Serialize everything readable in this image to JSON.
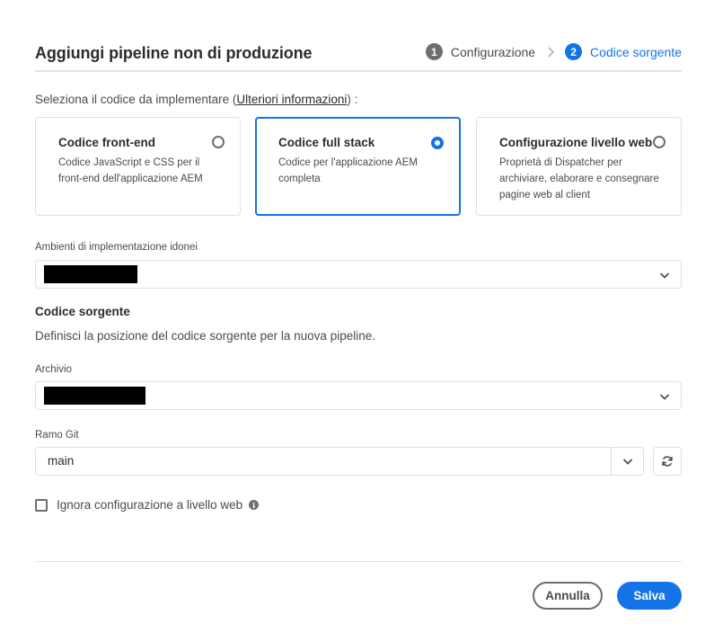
{
  "dialog": {
    "title": "Aggiungi pipeline non di produzione"
  },
  "stepper": {
    "steps": [
      {
        "number": "1",
        "label": "Configurazione",
        "state": "done"
      },
      {
        "number": "2",
        "label": "Codice sorgente",
        "state": "active"
      }
    ]
  },
  "code_selection": {
    "prompt_before": "Seleziona il codice da implementare (",
    "link_label": "Ulteriori informazioni",
    "prompt_after": ") :",
    "options": [
      {
        "title": "Codice front-end",
        "description": "Codice JavaScript e CSS per il front-end dell'applicazione AEM",
        "selected": false
      },
      {
        "title": "Codice full stack",
        "description": "Codice per l'applicazione AEM completa",
        "selected": true
      },
      {
        "title": "Configurazione livello web",
        "description": "Proprietà di Dispatcher per archiviare, elaborare e consegnare pagine web al client",
        "selected": false
      }
    ]
  },
  "environments": {
    "label": "Ambienti di implementazione idonei",
    "value_redacted": true
  },
  "source": {
    "title": "Codice sorgente",
    "description": "Definisci la posizione del codice sorgente per la nuova pipeline.",
    "repository_label": "Archivio",
    "repository_value_redacted": true,
    "branch_label": "Ramo Git",
    "branch_value": "main"
  },
  "web_tier": {
    "checkbox_label": "Ignora configurazione a livello web",
    "checked": false,
    "info_icon": "info-icon"
  },
  "footer": {
    "cancel_label": "Annulla",
    "save_label": "Salva"
  },
  "colors": {
    "accent": "#1473e6",
    "text": "#2c2c2c",
    "border": "#e1e1e1"
  }
}
